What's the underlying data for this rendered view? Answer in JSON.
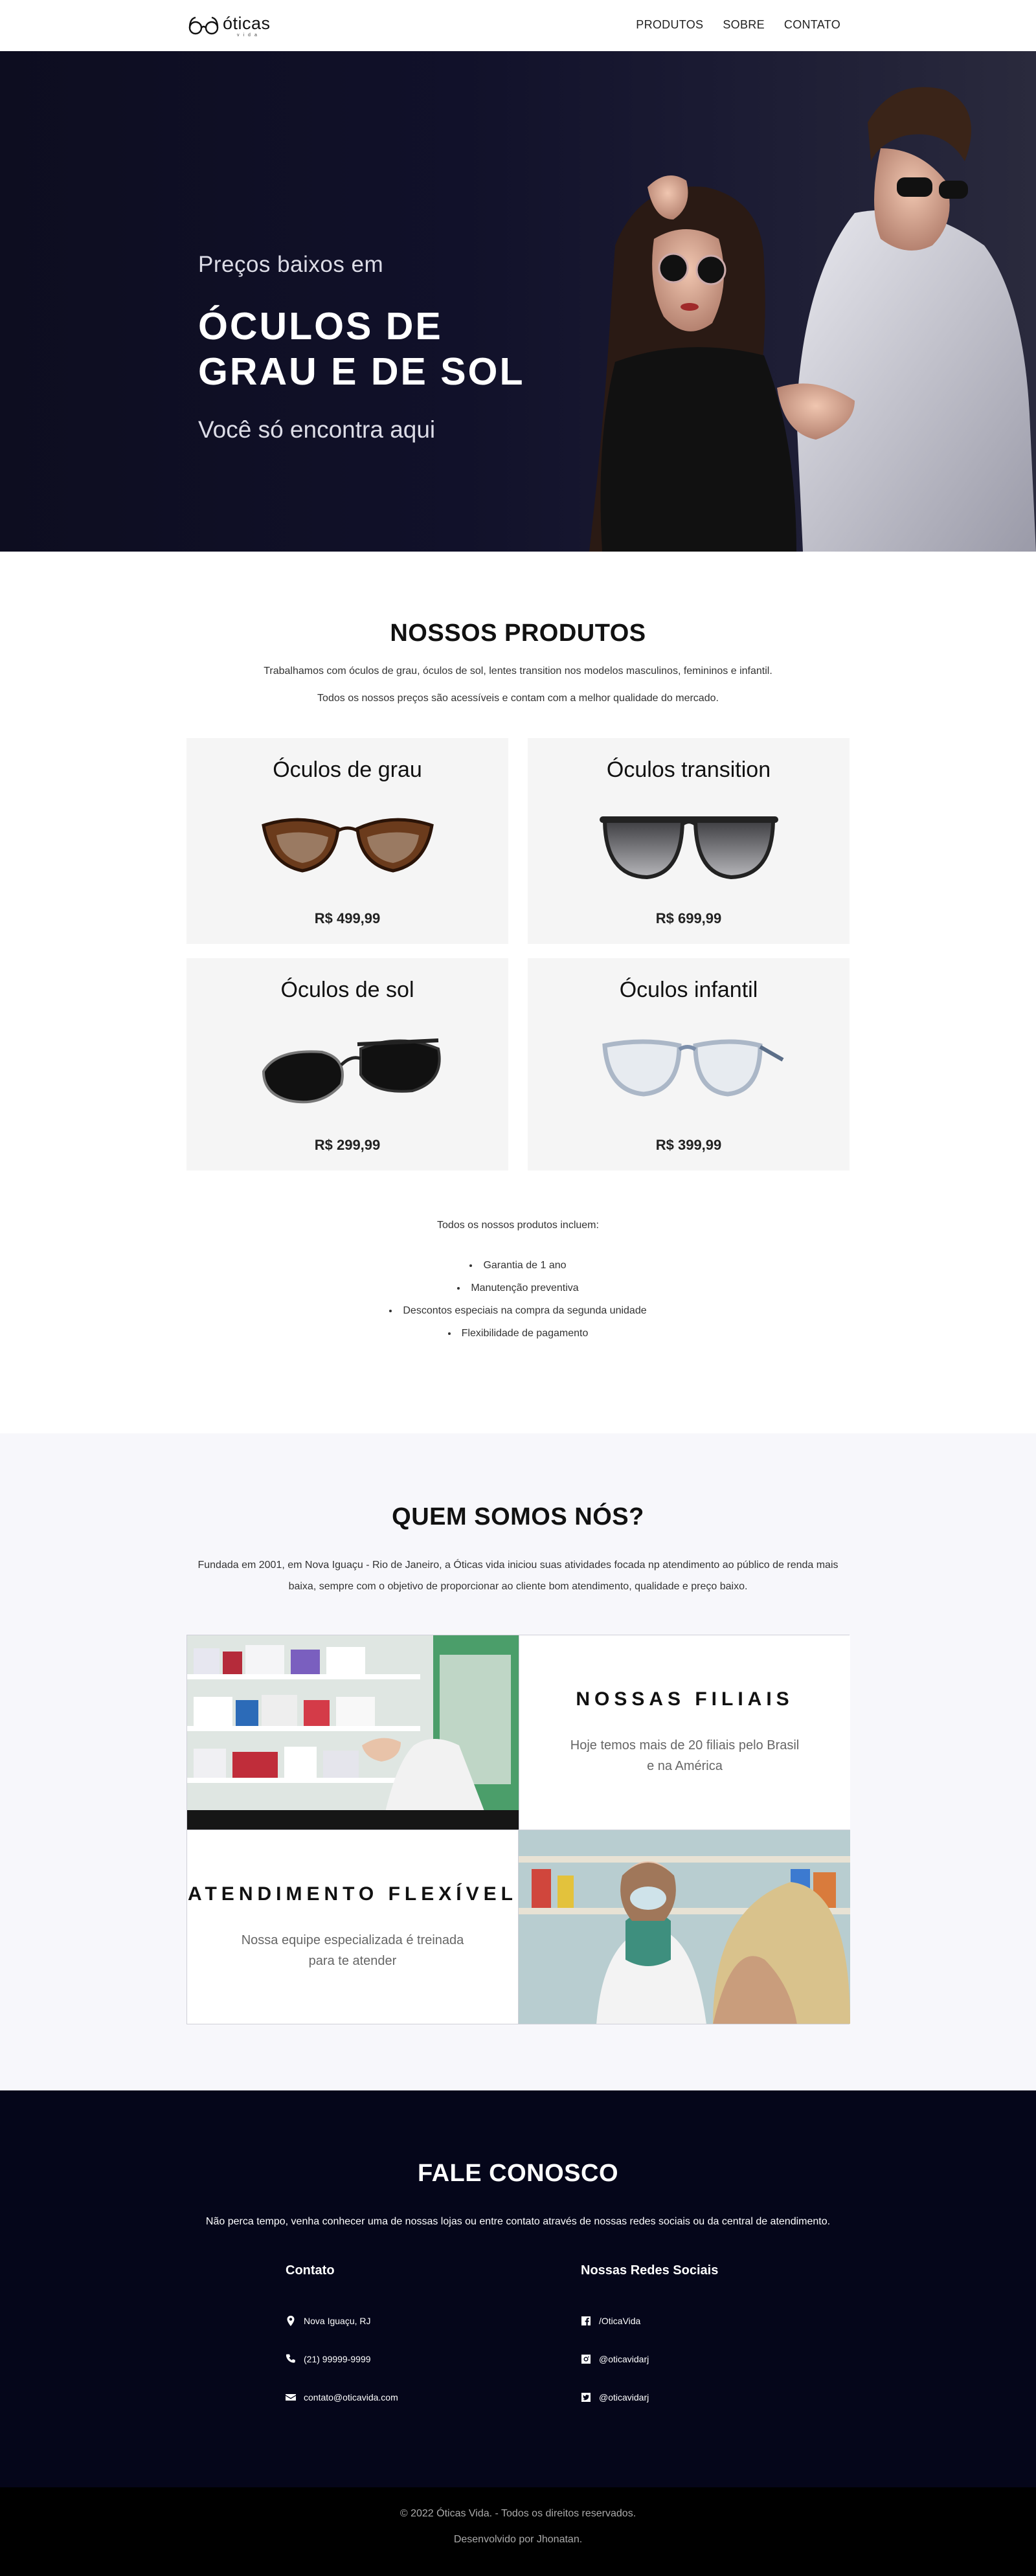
{
  "header": {
    "logo_text": "óticas",
    "logo_sub": "vida",
    "nav": [
      "PRODUTOS",
      "SOBRE",
      "CONTATO"
    ]
  },
  "hero": {
    "pre": "Preços baixos em",
    "title_line1": "ÓCULOS DE",
    "title_line2": "GRAU E DE SOL",
    "sub": "Você só encontra aqui"
  },
  "products": {
    "title": "NOSSOS PRODUTOS",
    "desc1": "Trabalhamos com óculos de grau, óculos de sol, lentes transition nos modelos masculinos, femininos e infantil.",
    "desc2": "Todos os nossos preços são acessíveis e contam com a melhor qualidade do mercado.",
    "items": [
      {
        "name": "Óculos de grau",
        "price": "R$ 499,99",
        "icon": "cat-eye-glasses-icon"
      },
      {
        "name": "Óculos transition",
        "price": "R$ 699,99",
        "icon": "transition-glasses-icon"
      },
      {
        "name": "Óculos de sol",
        "price": "R$ 299,99",
        "icon": "sunglasses-icon"
      },
      {
        "name": "Óculos infantil",
        "price": "R$ 399,99",
        "icon": "kids-glasses-icon"
      }
    ],
    "includes_title": "Todos os nossos produtos incluem:",
    "includes": [
      "Garantia de 1 ano",
      "Manutenção preventiva",
      "Descontos especiais na compra da segunda unidade",
      "Flexibilidade de pagamento"
    ]
  },
  "about": {
    "title": "QUEM SOMOS NÓS?",
    "desc": "Fundada em 2001, em Nova Iguaçu - Rio de Janeiro, a Óticas vida iniciou suas atividades focada np atendimento ao público de renda mais baixa, sempre com o objetivo de proporcionar ao cliente bom atendimento, qualidade e preço baixo.",
    "tile1_title": "NOSSAS FILIAIS",
    "tile1_text": "Hoje temos mais de 20 filiais pelo Brasil e na América",
    "tile2_title": "ATENDIMENTO FLEXÍVEL",
    "tile2_text": "Nossa equipe especializada é treinada para te atender"
  },
  "contact": {
    "title": "FALE CONOSCO",
    "desc": "Não perca tempo, venha conhecer uma de nossas lojas ou entre contato através de nossas redes sociais ou da central de atendimento.",
    "col1_title": "Contato",
    "address": "Nova Iguaçu, RJ",
    "phone": "(21) 99999-9999",
    "email": "contato@oticavida.com",
    "col2_title": "Nossas Redes Sociais",
    "facebook": "/OticaVida",
    "instagram": "@oticavidarj",
    "twitter": "@oticavidarj"
  },
  "footer": {
    "copyright": "© 2022 Óticas Vida. - Todos os direitos reservados.",
    "dev": "Desenvolvido por Jhonatan."
  }
}
